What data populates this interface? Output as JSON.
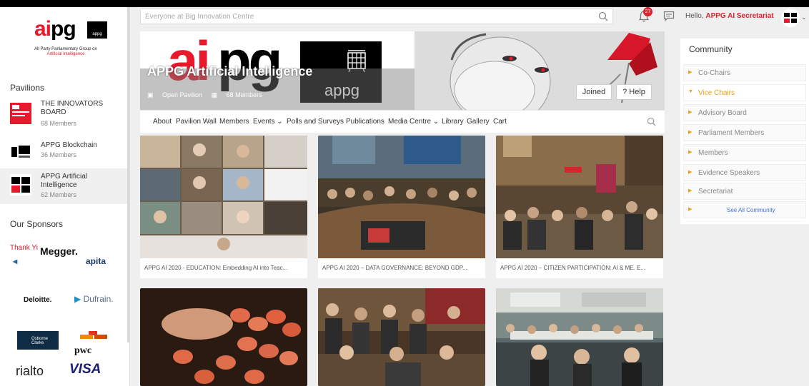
{
  "sidebar": {
    "logo": {
      "mark_ai": "ai",
      "mark_pg": "pg",
      "mark_appg": "appg",
      "subtitle": "All Party Parliamentary Group on",
      "subtitle_accent": "Artificial Intelligence"
    },
    "pavilions_heading": "Pavilions",
    "pavilions": [
      {
        "name": "THE INNOVATORS BOARD",
        "members": "68 Members",
        "thumb_icon": "innovators-board-logo"
      },
      {
        "name": "APPG Blockchain",
        "members": "36 Members",
        "thumb_icon": "appg-blockchain-logo"
      },
      {
        "name": "APPG Artificial Intelligence",
        "members": "62 Members",
        "thumb_icon": "appg-ai-logo"
      }
    ],
    "sponsors_heading": "Our Sponsors",
    "thanks_text": "Thank Yi",
    "sponsors": [
      "Megger.",
      "apita",
      "Deloitte.",
      "Dufrain.",
      "Osborne Clarke",
      "pwc",
      "rialto",
      "VISA"
    ]
  },
  "header": {
    "search_placeholder": "Everyone at Big Innovation Centre",
    "notification_count": "27",
    "hello_prefix": "Hello, ",
    "user_name": "APPG AI Secretariat"
  },
  "banner": {
    "logo_ai": "ai",
    "logo_pg": "pg",
    "logo_appg": "appg",
    "title": "APPG Artificial Intelligence",
    "privacy": "Open Pavilion",
    "members": "68 Members",
    "joined_label": "Joined",
    "help_label": "? Help"
  },
  "subnav": {
    "items": [
      "About",
      "Pavilion Wall",
      "Members",
      "Events ⌄",
      "Polls and Surveys",
      "Publications",
      "Media Centre ⌄",
      "Library",
      "Gallery",
      "Cart"
    ]
  },
  "cards": [
    {
      "caption": "APPG AI 2020 - EDUCATION: Embedding AI into Teac..."
    },
    {
      "caption": "APPG AI 2020 – DATA GOVERNANCE: BEYOND GDP..."
    },
    {
      "caption": "APPG AI 2020 – CITIZEN PARTICIPATION: AI & ME. E..."
    },
    {
      "caption": ""
    },
    {
      "caption": ""
    },
    {
      "caption": ""
    }
  ],
  "community": {
    "title": "Community",
    "items": [
      "Co-Chairs",
      "Vice Chairs",
      "Advisory Board",
      "Parliament Members",
      "Members",
      "Evidence Speakers",
      "Secretariat"
    ],
    "see_all": "See All Community"
  },
  "colors": {
    "brand_red": "#e8192c",
    "accent_orange": "#e4a11b",
    "link_blue": "#3b6fd8"
  }
}
